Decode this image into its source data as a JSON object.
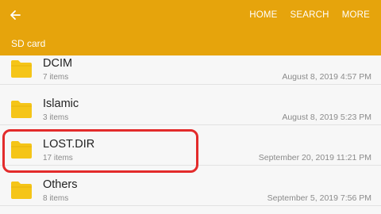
{
  "appbar": {
    "path": "SD card",
    "actions": [
      "HOME",
      "SEARCH",
      "MORE"
    ],
    "back_icon": "arrow-left-icon",
    "background": "#e6a40c"
  },
  "folders": [
    {
      "name": "DCIM",
      "count": "7 items",
      "date": "August 8, 2019 4:57 PM"
    },
    {
      "name": "Islamic",
      "count": "3 items",
      "date": "August 8, 2019 5:23 PM"
    },
    {
      "name": "LOST.DIR",
      "count": "17 items",
      "date": "September 20, 2019 11:21 PM",
      "highlighted": true
    },
    {
      "name": "Others",
      "count": "8 items",
      "date": "September 5, 2019 7:56 PM"
    }
  ],
  "colors": {
    "folder": "#f5c518",
    "highlight": "#e32b2b"
  }
}
